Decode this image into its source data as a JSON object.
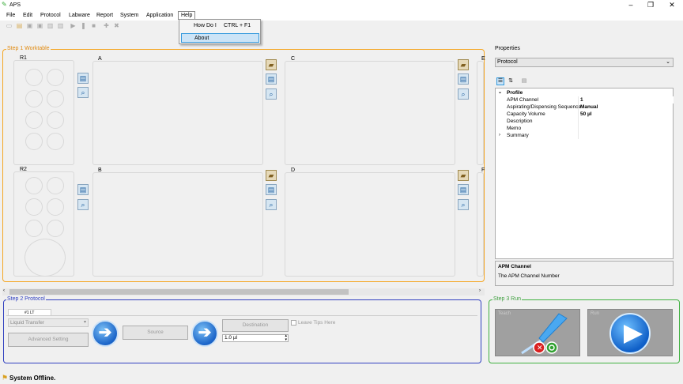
{
  "window": {
    "title": "APS",
    "controls": [
      "–",
      "❐",
      "✕"
    ]
  },
  "menubar": [
    "File",
    "Edit",
    "Protocol",
    "Labware",
    "Report",
    "System",
    "Application",
    "Help"
  ],
  "help_menu": {
    "items": [
      {
        "label": "How Do I",
        "shortcut": "CTRL + F1"
      },
      {
        "label": "About"
      }
    ]
  },
  "step1": {
    "title": "Step 1 Worktable",
    "racks": [
      "R1",
      "R2"
    ],
    "positions": [
      "A",
      "B",
      "C",
      "D",
      "E",
      "F"
    ]
  },
  "step2": {
    "title": "Step 2 Protocol",
    "tab": "#1 LT",
    "method": "Liquid Transfer",
    "advanced": "Advanced Setting",
    "source": "Source",
    "destination": "Destination",
    "leave_tips": "Leave Tips Here",
    "volume": "1.0 µl"
  },
  "step3": {
    "title": "Step 3 Run",
    "setup_label": "Teach",
    "run_label": "Run"
  },
  "properties": {
    "title": "Properties",
    "selected": "Protocol",
    "category": "Profile",
    "rows": [
      {
        "name": "APM Channel",
        "value": "1"
      },
      {
        "name": "Aspirating/Dispensing Sequence",
        "value": "Manual"
      },
      {
        "name": "Capacity Volume",
        "value": "50 µl"
      },
      {
        "name": "Description",
        "value": ""
      },
      {
        "name": "Memo",
        "value": ""
      },
      {
        "name": "Summary",
        "value": ""
      }
    ],
    "help_title": "APM Channel",
    "help_text": "The APM Channel Number"
  },
  "status": {
    "text": "System Offline."
  },
  "colors": {
    "step1": "#f5a623",
    "step2": "#3040c0",
    "step3": "#40b040"
  }
}
